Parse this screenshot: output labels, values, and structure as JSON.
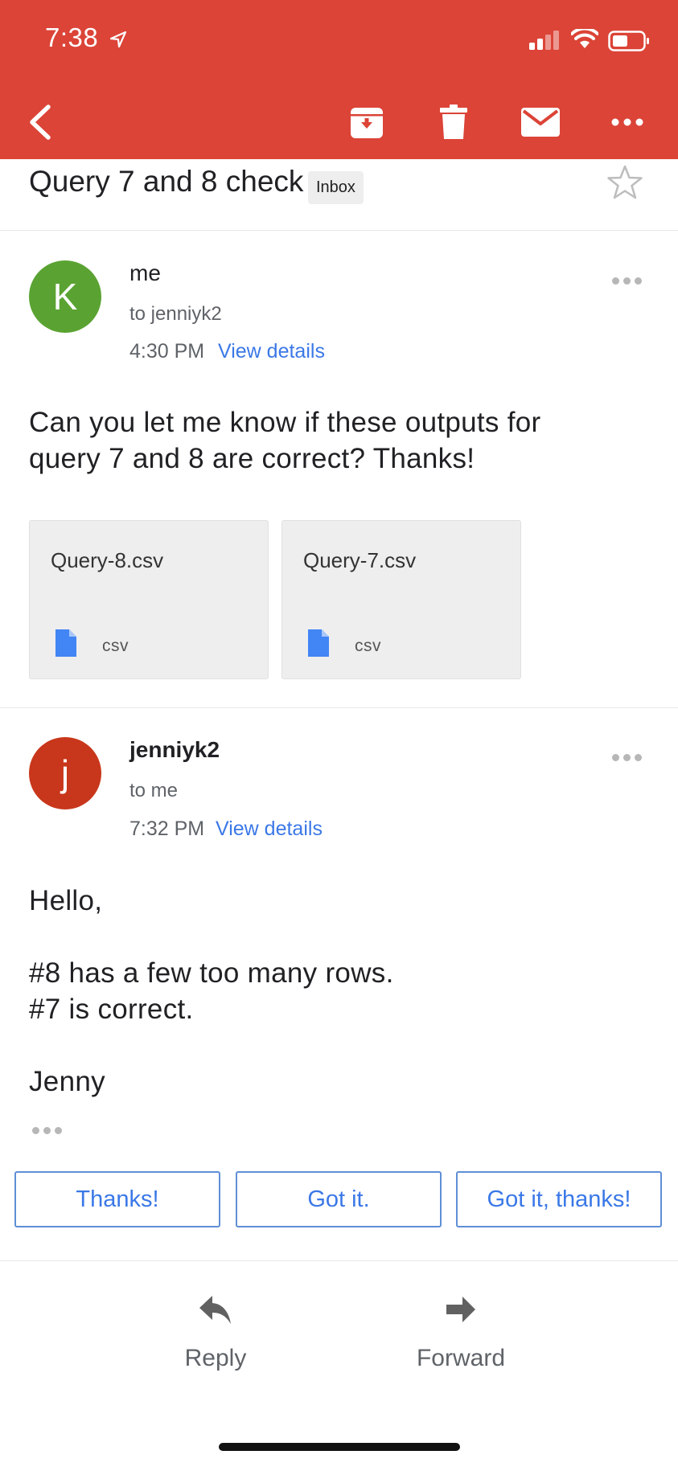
{
  "status_bar": {
    "time": "7:38"
  },
  "colors": {
    "header": "#db4437",
    "link": "#3b78e7",
    "avatar_me": "#5aa332",
    "avatar_jenny": "#c8371b"
  },
  "toolbar": {
    "icons": [
      "back-arrow-icon",
      "archive-icon",
      "trash-icon",
      "mail-icon",
      "more-icon"
    ]
  },
  "thread": {
    "subject": "Query 7 and 8 check",
    "label": "Inbox"
  },
  "messages": [
    {
      "avatar_letter": "K",
      "sender": "me",
      "recipient": "to jenniyk2",
      "time": "4:30 PM",
      "details_link": "View details",
      "body": [
        "Can you let me know if these outputs for",
        "query 7 and 8 are correct? Thanks!"
      ],
      "attachments": [
        {
          "name": "Query-8.csv",
          "type": "csv"
        },
        {
          "name": "Query-7.csv",
          "type": "csv"
        }
      ]
    },
    {
      "avatar_letter": "j",
      "sender": "jenniyk2",
      "recipient": "to me",
      "time": "7:32 PM",
      "details_link": "View details",
      "body": [
        "Hello,",
        "#8 has a few too many rows.",
        "#7 is correct.",
        "Jenny"
      ]
    }
  ],
  "smart_replies": [
    "Thanks!",
    "Got it.",
    "Got it, thanks!"
  ],
  "actions": {
    "reply": "Reply",
    "forward": "Forward"
  }
}
